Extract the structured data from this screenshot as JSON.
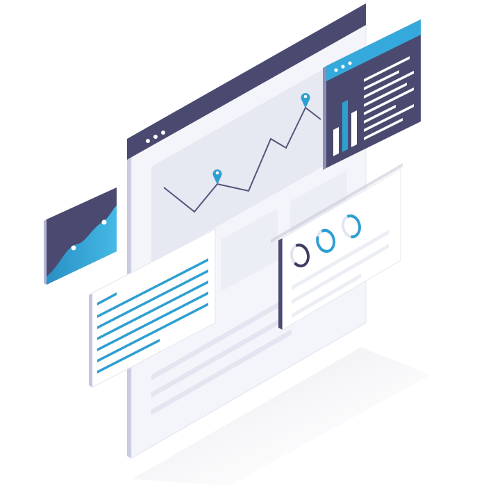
{
  "illustration": {
    "kind": "isometric analytics dashboard",
    "palette": {
      "navy": "#4a4a70",
      "navy_dark": "#3d3d63",
      "blue": "#2e9fd1",
      "blue_light": "#44b7e3",
      "panel_white": "#ffffff",
      "panel_gray": "#f4f5fa",
      "placeholder": "#e9ebf3",
      "edge": "#d8daea",
      "line": "#555379"
    },
    "main_window": {
      "control_dots": 3,
      "line_chart": {
        "series_shape": [
          2,
          0,
          4,
          3,
          9,
          6,
          12,
          10
        ],
        "marked_points": [
          2,
          6
        ]
      }
    },
    "top_right_card": {
      "control_dots": 3,
      "bars": [
        {
          "level": 0.4,
          "color": "#ffffff"
        },
        {
          "level": 1.0,
          "color": "#2e9fd1"
        },
        {
          "level": 0.65,
          "color": "#ffffff"
        }
      ],
      "text_lines": 8
    },
    "left_card": {
      "theme": "area-chart",
      "marked_points": 2
    },
    "text_card": {
      "text_lines": 6,
      "accent_color": "#2e9fd1"
    },
    "progress_card": {
      "rings": [
        {
          "fill": 0.55,
          "color": "#3d3d63"
        },
        {
          "fill": 0.75,
          "color": "#2e9fd1"
        },
        {
          "fill": 0.6,
          "color": "#2e9fd1"
        }
      ]
    }
  }
}
